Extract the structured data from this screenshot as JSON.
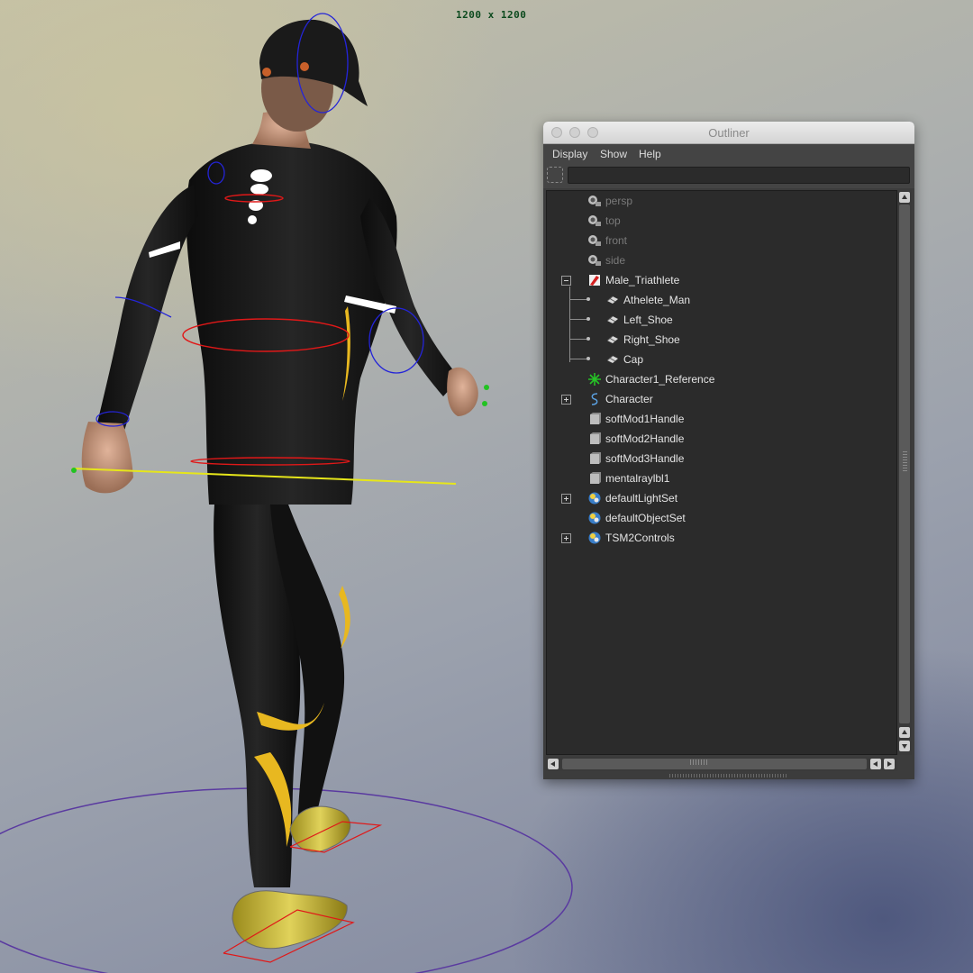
{
  "viewport": {
    "resolution_label": "1200 x 1200"
  },
  "outliner": {
    "title": "Outliner",
    "menu": [
      "Display",
      "Show",
      "Help"
    ],
    "filter": {
      "value": ""
    },
    "items": [
      {
        "label": "persp",
        "icon": "camera-icon",
        "depth": 0,
        "dim": true
      },
      {
        "label": "top",
        "icon": "camera-icon",
        "depth": 0,
        "dim": true
      },
      {
        "label": "front",
        "icon": "camera-icon",
        "depth": 0,
        "dim": true
      },
      {
        "label": "side",
        "icon": "camera-icon",
        "depth": 0,
        "dim": true
      },
      {
        "label": "Male_Triathlete",
        "icon": "group-icon",
        "depth": 0,
        "expander": "minus"
      },
      {
        "label": "Athelete_Man",
        "icon": "mesh-icon",
        "depth": 1
      },
      {
        "label": "Left_Shoe",
        "icon": "mesh-icon",
        "depth": 1
      },
      {
        "label": "Right_Shoe",
        "icon": "mesh-icon",
        "depth": 1
      },
      {
        "label": "Cap",
        "icon": "mesh-icon",
        "depth": 1
      },
      {
        "label": "Character1_Reference",
        "icon": "joint-icon",
        "depth": 0
      },
      {
        "label": "Character",
        "icon": "curve-icon",
        "depth": 0,
        "expander": "plus"
      },
      {
        "label": "softMod1Handle",
        "icon": "handle-icon",
        "depth": 0
      },
      {
        "label": "softMod2Handle",
        "icon": "handle-icon",
        "depth": 0
      },
      {
        "label": "softMod3Handle",
        "icon": "handle-icon",
        "depth": 0
      },
      {
        "label": "mentalraylbl1",
        "icon": "handle-icon",
        "depth": 0
      },
      {
        "label": "defaultLightSet",
        "icon": "set-icon",
        "depth": 0,
        "expander": "plus"
      },
      {
        "label": "defaultObjectSet",
        "icon": "set-icon",
        "depth": 0
      },
      {
        "label": "TSM2Controls",
        "icon": "set-icon",
        "depth": 0,
        "expander": "plus"
      }
    ]
  },
  "colors": {
    "suit": "#141414",
    "suit_stripe": "#e8b820",
    "control_blue": "#2424d8",
    "control_red": "#e01818",
    "control_yellow": "#e6e61a",
    "ground_ring": "#5a3aa0"
  }
}
